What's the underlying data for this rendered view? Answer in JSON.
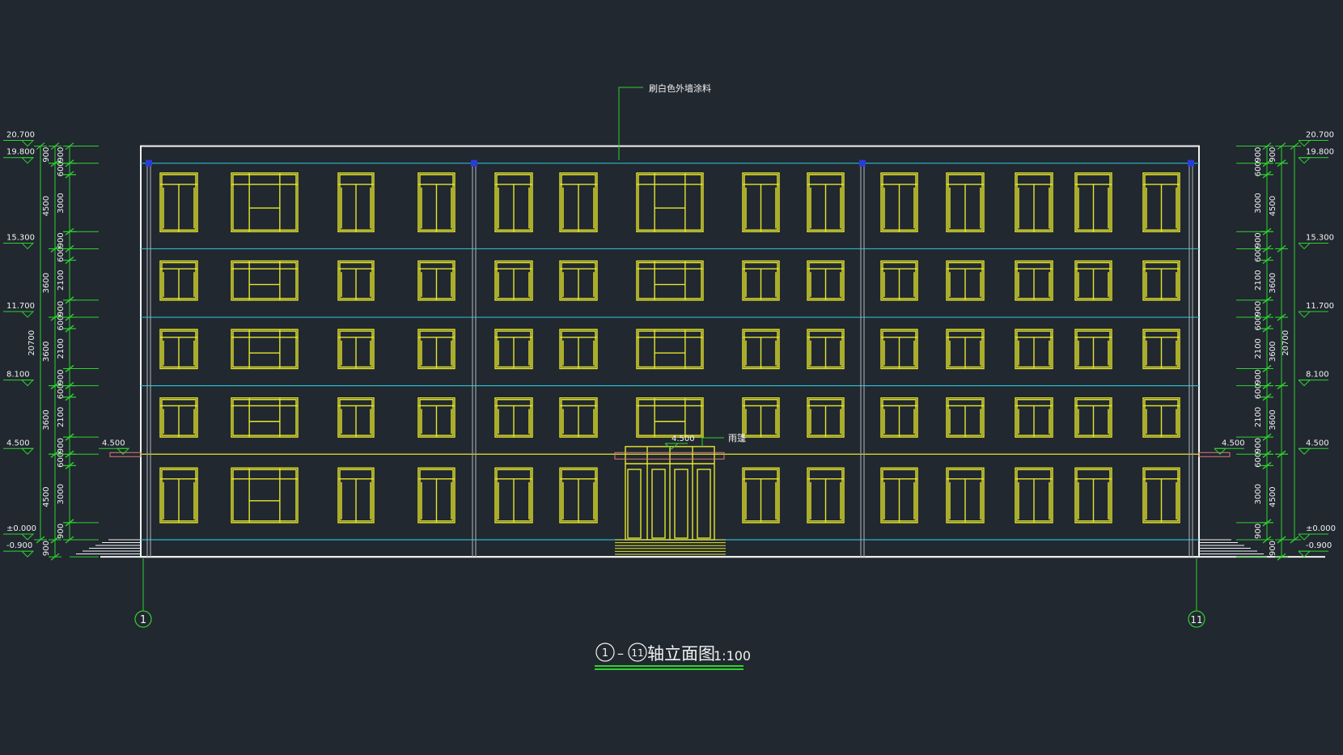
{
  "drawing": {
    "title_axis_start": "1",
    "title_dash": "–",
    "title_axis_end": "11",
    "title_text": "轴立面图",
    "scale": "1:100",
    "annotation_wall": "刷白色外墙涂料",
    "annotation_canopy": "雨篷",
    "canopy_level": "4.500",
    "axis_left": "1",
    "axis_right": "11"
  },
  "levels": [
    {
      "label": "20.700",
      "y": 20.7
    },
    {
      "label": "19.800",
      "y": 19.8
    },
    {
      "label": "15.300",
      "y": 15.3
    },
    {
      "label": "11.700",
      "y": 11.7
    },
    {
      "label": "8.100",
      "y": 8.1
    },
    {
      "label": "4.500",
      "y": 4.5
    },
    {
      "label": "±0.000",
      "y": 0.0
    },
    {
      "label": "-0.900",
      "y": -0.9
    }
  ],
  "side_levels": {
    "left_ramp": "4.500",
    "right_ramp": "4.500"
  },
  "dims_inner": [
    {
      "label": "900",
      "from": 19.8,
      "to": 20.7
    },
    {
      "label": "600",
      "from": 19.2,
      "to": 19.8
    },
    {
      "label": "3000",
      "from": 16.2,
      "to": 19.2
    },
    {
      "label": "900",
      "from": 15.3,
      "to": 16.2
    },
    {
      "label": "600",
      "from": 14.7,
      "to": 15.3
    },
    {
      "label": "2100",
      "from": 12.6,
      "to": 14.7
    },
    {
      "label": "900",
      "from": 11.7,
      "to": 12.6
    },
    {
      "label": "600",
      "from": 11.1,
      "to": 11.7
    },
    {
      "label": "2100",
      "from": 9.0,
      "to": 11.1
    },
    {
      "label": "900",
      "from": 8.1,
      "to": 9.0
    },
    {
      "label": "600",
      "from": 7.5,
      "to": 8.1
    },
    {
      "label": "2100",
      "from": 5.4,
      "to": 7.5
    },
    {
      "label": "900",
      "from": 4.5,
      "to": 5.4
    },
    {
      "label": "600",
      "from": 3.9,
      "to": 4.5
    },
    {
      "label": "3000",
      "from": 0.9,
      "to": 3.9
    },
    {
      "label": "900",
      "from": 0.0,
      "to": 0.9
    }
  ],
  "dims_mid": [
    {
      "label": "900",
      "from": 19.8,
      "to": 20.7
    },
    {
      "label": "4500",
      "from": 15.3,
      "to": 19.8
    },
    {
      "label": "3600",
      "from": 11.7,
      "to": 15.3
    },
    {
      "label": "3600",
      "from": 8.1,
      "to": 11.7
    },
    {
      "label": "3600",
      "from": 4.5,
      "to": 8.1
    },
    {
      "label": "4500",
      "from": 0.0,
      "to": 4.5
    },
    {
      "label": "900",
      "from": -0.9,
      "to": 0.0
    }
  ],
  "dims_total": [
    {
      "label": "20700",
      "from": 0.0,
      "to": 20.7
    }
  ],
  "colors": {
    "background": "#212830",
    "dimension": "#2fd12f",
    "window": "#e6e62c",
    "floor_line": "#2ab8c8",
    "outline": "#f2f2f2",
    "canopy": "#e07a7a",
    "pilaster": "#9aa0a6",
    "marker": "#2a3cd6"
  }
}
